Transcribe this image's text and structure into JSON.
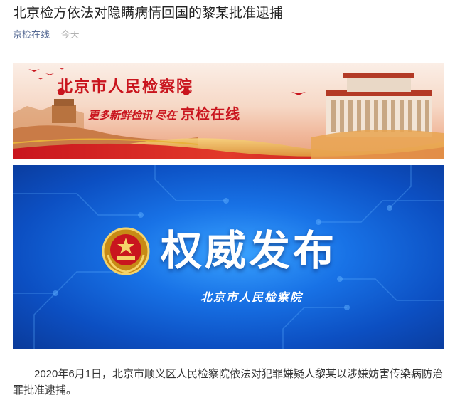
{
  "article": {
    "title": "北京检方依法对隐瞒病情回国的黎某批准逮捕",
    "account": "京检在线",
    "date": "今天",
    "paragraph": "2020年6月1日，北京市顺义区人民检察院依法对犯罪嫌疑人黎某以涉嫌妨害传染病防治罪批准逮捕。"
  },
  "banner_top": {
    "org_name": "北京市人民检察院",
    "slogan": "更多新鲜检讯 尽在",
    "slogan_highlight": "京检在线"
  },
  "banner_main": {
    "headline": "权威发布",
    "org_name": "北京市人民检察院"
  },
  "icons": [
    "procuratorate-emblem-icon",
    "great-wall-illustration",
    "building-illustration"
  ],
  "colors": {
    "link": "#576b95",
    "banner_red": "#c9151e",
    "banner_blue": "#1872e6"
  }
}
